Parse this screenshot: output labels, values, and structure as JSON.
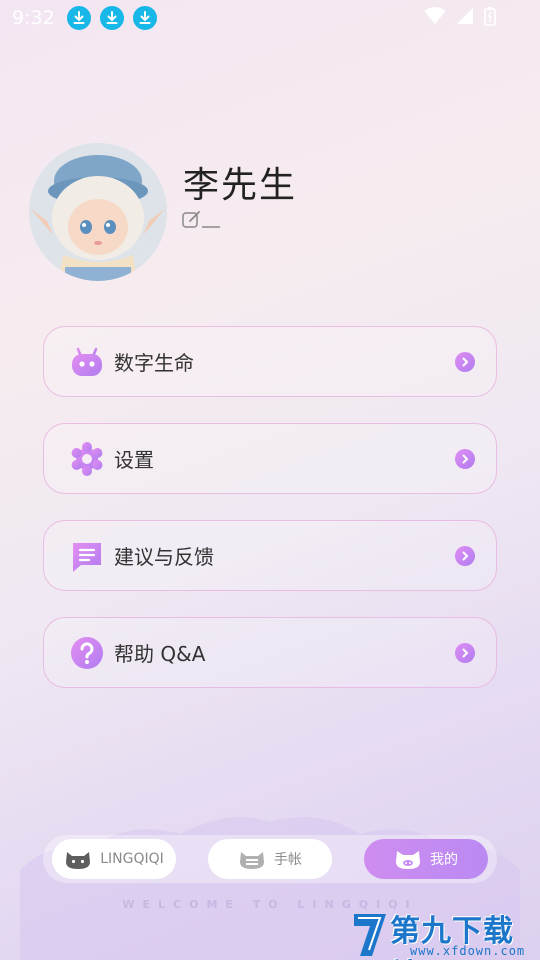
{
  "status_bar": {
    "time": "9:32",
    "download_notifications": 3
  },
  "profile": {
    "name": "李先生"
  },
  "menu": [
    {
      "label": "数字生命",
      "icon": "robot-icon"
    },
    {
      "label": "设置",
      "icon": "gear-icon"
    },
    {
      "label": "建议与反馈",
      "icon": "feedback-icon"
    },
    {
      "label": "帮助 Q&A",
      "icon": "help-icon"
    }
  ],
  "bottom_nav": {
    "tabs": [
      {
        "label": "LINGQIQI",
        "active": false
      },
      {
        "label": "手帐",
        "active": false
      },
      {
        "label": "我的",
        "active": true
      }
    ],
    "welcome": "WELCOME TO LINGQIQI"
  },
  "watermark": {
    "title": "第九下载站",
    "url": "www.xfdown.com"
  },
  "colors": {
    "accent": "#c98af2",
    "status_download": "#17b7e8"
  }
}
